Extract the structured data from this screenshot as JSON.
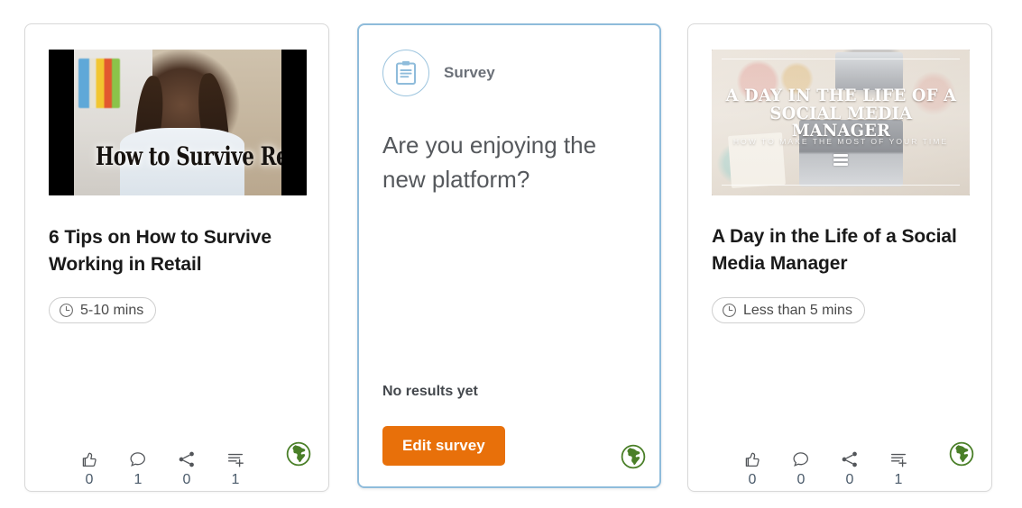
{
  "cards": [
    {
      "type": "content",
      "kind": "video",
      "thumbnail_caption": "How to Survive Retail",
      "title": "6 Tips on How to Survive Working in Retail",
      "duration": "5-10 mins",
      "duration_icon": "clock-icon",
      "visibility_icon": "globe-icon",
      "visibility_color": "#4a7f28",
      "actions": [
        {
          "icon": "thumbs-up-icon",
          "name": "like",
          "count": "0"
        },
        {
          "icon": "comment-icon",
          "name": "comment",
          "count": "1"
        },
        {
          "icon": "share-icon",
          "name": "share",
          "count": "0"
        },
        {
          "icon": "add-to-list-icon",
          "name": "add-to-list",
          "count": "1"
        }
      ]
    },
    {
      "type": "survey",
      "header_label": "Survey",
      "header_icon": "clipboard-icon",
      "question": "Are you enjoying the new platform?",
      "results_status": "No results yet",
      "button_label": "Edit survey",
      "button_color": "#e8700a",
      "border_color": "#8fbcdb",
      "visibility_icon": "globe-icon",
      "visibility_color": "#4a7f28"
    },
    {
      "type": "content",
      "kind": "article",
      "thumbnail_title": "A DAY IN THE LIFE OF A SOCIAL MEDIA MANAGER",
      "thumbnail_title_line1": "A DAY IN THE LIFE OF A",
      "thumbnail_title_line2": "SOCIAL MEDIA MANAGER",
      "thumbnail_subtitle": "HOW TO MAKE THE MOST OF YOUR TIME",
      "thumbnail_overlay_icon": "stacked-layers-icon",
      "title": "A Day in the Life of a Social Media Manager",
      "duration": "Less than 5 mins",
      "duration_icon": "clock-icon",
      "visibility_icon": "globe-icon",
      "visibility_color": "#4a7f28",
      "actions": [
        {
          "icon": "thumbs-up-icon",
          "name": "like",
          "count": "0"
        },
        {
          "icon": "comment-icon",
          "name": "comment",
          "count": "0"
        },
        {
          "icon": "share-icon",
          "name": "share",
          "count": "0"
        },
        {
          "icon": "add-to-list-icon",
          "name": "add-to-list",
          "count": "1"
        }
      ]
    }
  ]
}
